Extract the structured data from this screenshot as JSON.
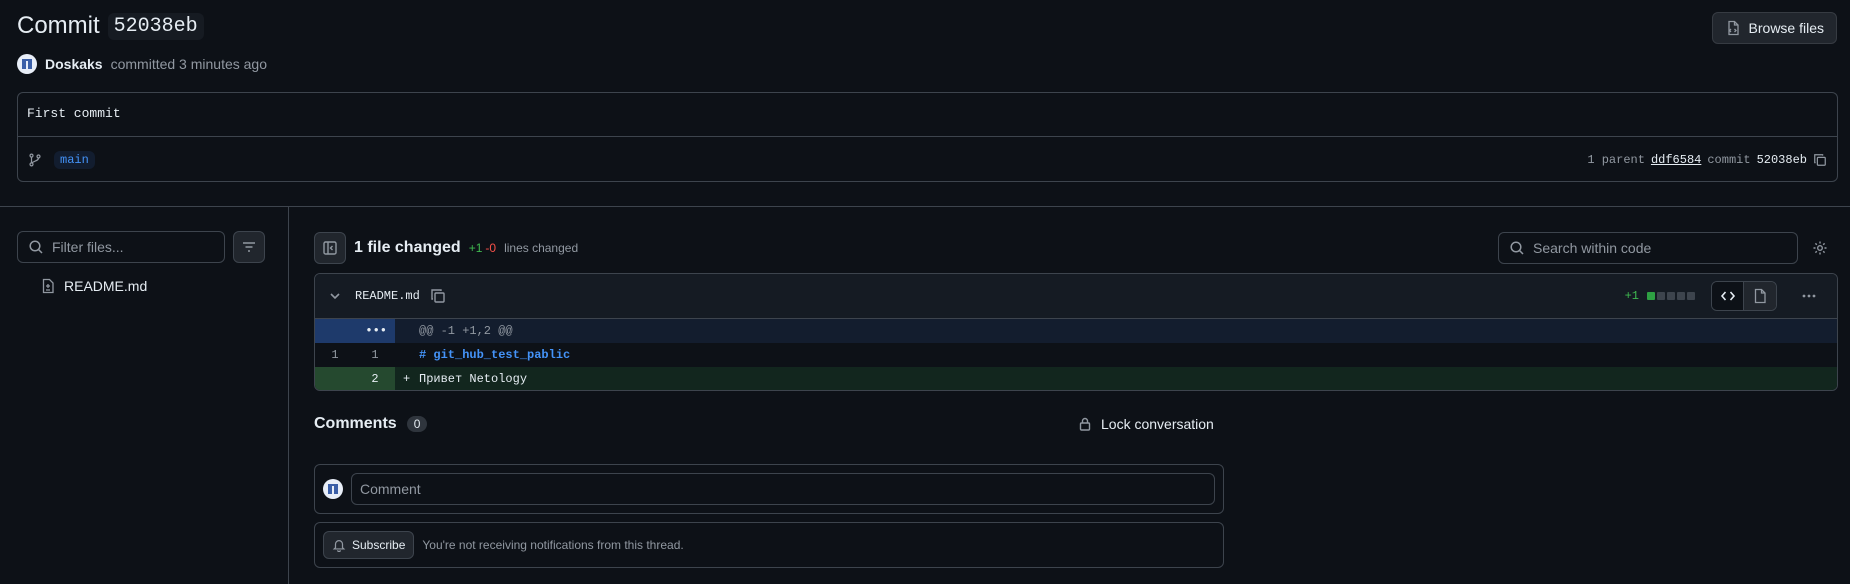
{
  "header": {
    "title_prefix": "Commit",
    "sha": "52038eb",
    "browse_label": "Browse files",
    "author": "Doskaks",
    "committed_text": "committed 3 minutes ago"
  },
  "commit": {
    "message": "First commit",
    "branch": "main",
    "parent_label": "1 parent",
    "parent_sha": "ddf6584",
    "commit_label": "commit",
    "commit_sha": "52038eb"
  },
  "sidebar": {
    "filter_placeholder": "Filter files...",
    "files": [
      {
        "name": "README.md"
      }
    ]
  },
  "diff_summary": {
    "files_changed": "1 file changed",
    "additions": "+1",
    "deletions": "-0",
    "lines_changed_label": "lines changed",
    "search_placeholder": "Search within code"
  },
  "file_diff": {
    "filename": "README.md",
    "additions": "+1",
    "hunk_header": "@@ -1 +1,2 @@",
    "expander": "•••",
    "lines": [
      {
        "old": "1",
        "new": "1",
        "sign": "",
        "text": "# git_hub_test_pablic"
      },
      {
        "old": "",
        "new": "2",
        "sign": "+",
        "text": "Привет Netology"
      }
    ]
  },
  "comments": {
    "heading": "Comments",
    "count": "0",
    "lock_label": "Lock conversation",
    "comment_placeholder": "Comment",
    "subscribe_label": "Subscribe",
    "subscribe_note": "You're not receiving notifications from this thread."
  },
  "colors": {
    "background": "#0d1117",
    "border": "#3d444d",
    "added": "#3fb950",
    "deleted": "#f85149",
    "accent": "#4493f8"
  },
  "icons": [
    "file-diff-icon",
    "branch-icon",
    "copy-icon",
    "search-icon",
    "filter-icon",
    "file-icon",
    "sidebar-toggle-icon",
    "gear-icon",
    "chevron-down-icon",
    "code-icon",
    "file-view-icon",
    "kebab-icon",
    "lock-icon",
    "bell-icon",
    "avatar"
  ]
}
